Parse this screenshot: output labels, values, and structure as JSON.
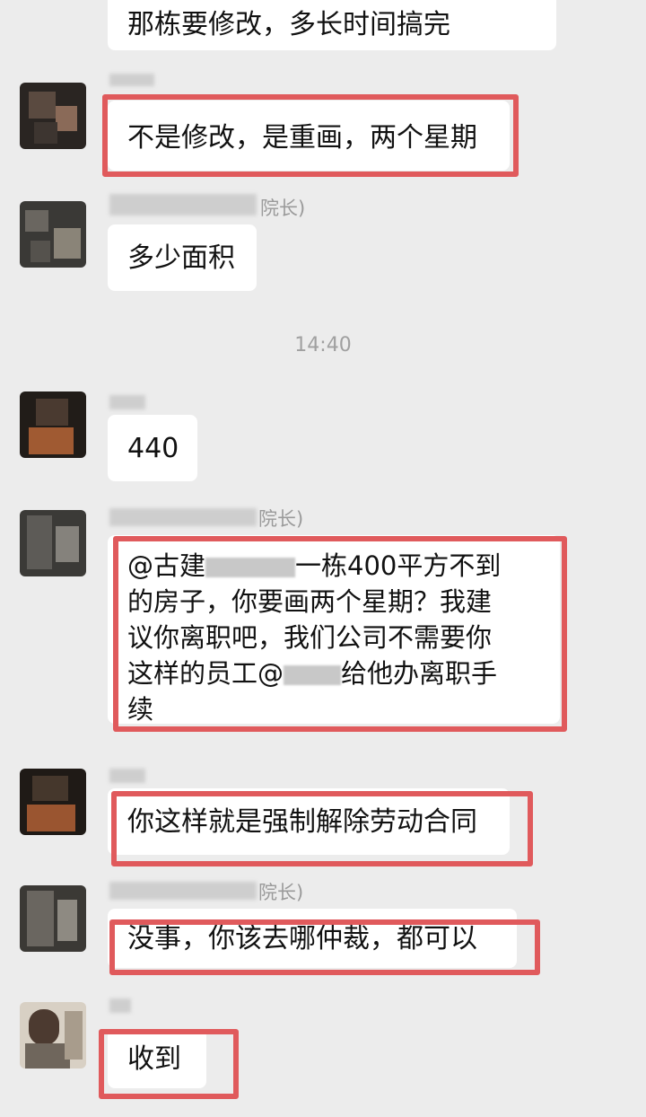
{
  "timestamp": "14:40",
  "messages": [
    {
      "sender": "",
      "text": "那栋要修改，多长时间搞完"
    },
    {
      "sender": "",
      "text": "不是修改，是重画，两个星期"
    },
    {
      "sender": "院长)",
      "text": "多少面积"
    },
    {
      "sender": "",
      "text": "440"
    },
    {
      "sender": "院长)",
      "text_lines": [
        "@古建",
        "一栋400平方不到",
        "的房子，你要画两个星期？我建",
        "议你离职吧，我们公司不需要你",
        "这样的员工@",
        "给他办离职手",
        "续"
      ]
    },
    {
      "sender": "",
      "text": "你这样就是强制解除劳动合同"
    },
    {
      "sender": "院长)",
      "text": "没事，你该去哪仲裁，都可以"
    },
    {
      "sender": "",
      "text": "收到"
    }
  ]
}
